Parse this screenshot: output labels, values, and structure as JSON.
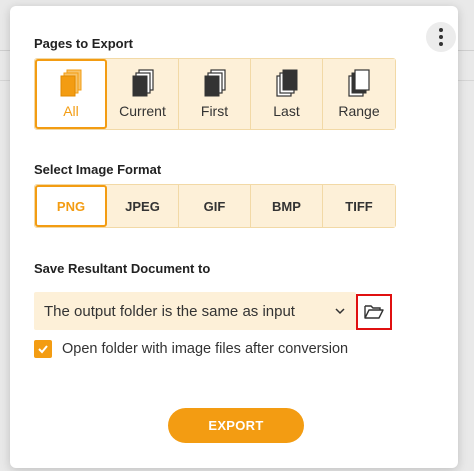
{
  "pages": {
    "heading": "Pages to Export",
    "options": [
      {
        "label": "All",
        "icon": "all-pages-icon",
        "selected": true
      },
      {
        "label": "Current",
        "icon": "current-page-icon",
        "selected": false
      },
      {
        "label": "First",
        "icon": "first-page-icon",
        "selected": false
      },
      {
        "label": "Last",
        "icon": "last-page-icon",
        "selected": false
      },
      {
        "label": "Range",
        "icon": "range-pages-icon",
        "selected": false
      }
    ]
  },
  "format": {
    "heading": "Select Image Format",
    "options": [
      {
        "label": "PNG",
        "selected": true
      },
      {
        "label": "JPEG",
        "selected": false
      },
      {
        "label": "GIF",
        "selected": false
      },
      {
        "label": "BMP",
        "selected": false
      },
      {
        "label": "TIFF",
        "selected": false
      }
    ]
  },
  "save": {
    "heading": "Save Resultant Document to",
    "selected_value": "The output folder is the same as input"
  },
  "open_folder": {
    "label": "Open folder with image files after conversion",
    "checked": true
  },
  "export_label": "EXPORT",
  "colors": {
    "accent": "#f39c12",
    "segment_bg": "#fdf0d8",
    "highlight_border": "#e01010"
  }
}
